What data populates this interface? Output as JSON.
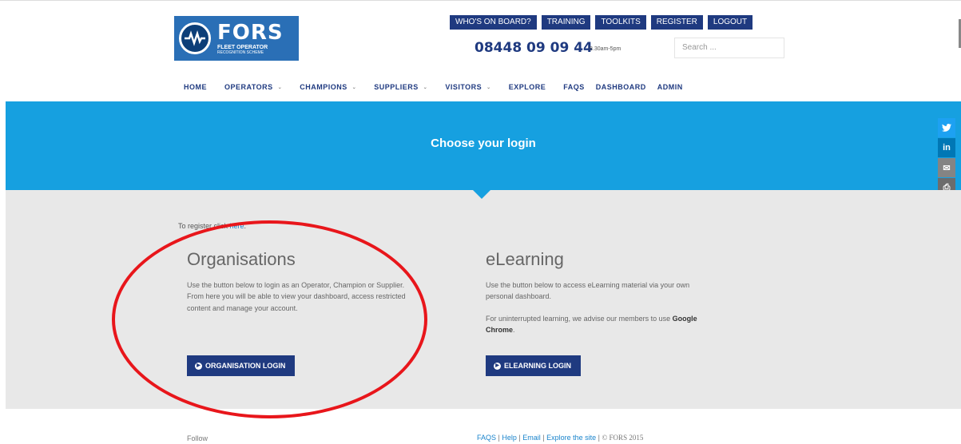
{
  "logo": {
    "title": "FORS",
    "subtitle": "FLEET OPERATOR",
    "tagline": "RECOGNITION SCHEME"
  },
  "top_buttons": [
    "WHO'S ON BOARD?",
    "TRAINING",
    "TOOLKITS",
    "REGISTER",
    "LOGOUT"
  ],
  "phone": "08448 09 09 44",
  "hours": "8.30am-5pm",
  "search": {
    "placeholder": "Search ..."
  },
  "nav": [
    {
      "label": "HOME",
      "dropdown": false
    },
    {
      "label": "OPERATORS",
      "dropdown": true
    },
    {
      "label": "CHAMPIONS",
      "dropdown": true
    },
    {
      "label": "SUPPLIERS",
      "dropdown": true
    },
    {
      "label": "VISITORS",
      "dropdown": true
    },
    {
      "label": "EXPLORE",
      "dropdown": false
    },
    {
      "label": "FAQS",
      "dropdown": false
    },
    {
      "label": "DASHBOARD",
      "dropdown": false
    },
    {
      "label": "ADMIN",
      "dropdown": false
    }
  ],
  "banner": {
    "title": "Choose your login"
  },
  "social": [
    {
      "icon": "twitter-icon",
      "glyph": "🐦",
      "color": "#1da1f2"
    },
    {
      "icon": "linkedin-icon",
      "glyph": "in",
      "color": "#0077b5"
    },
    {
      "icon": "email-icon",
      "glyph": "✉",
      "color": "#848484"
    },
    {
      "icon": "print-icon",
      "glyph": "⎙",
      "color": "#6c6c6c"
    }
  ],
  "register": {
    "prefix": "To register click",
    "link": "here",
    "suffix": "."
  },
  "organisations": {
    "title": "Organisations",
    "line1": "Use the button below to login as an Operator, Champion or Supplier.",
    "line2": "From here you will be able to view your dashboard, access restricted",
    "line3": "content and manage your account.",
    "button": "ORGANISATION LOGIN"
  },
  "elearning": {
    "title": "eLearning",
    "line1": "Use the button below to access eLearning material via your own",
    "line2": "personal dashboard.",
    "line3_prefix": "For uninterrupted learning, we advise our members to use",
    "line3_bold": "Google",
    "line4_bold": "Chrome",
    "line4_suffix": ".",
    "button": "ELEARNING LOGIN"
  },
  "footer": {
    "follow": "Follow",
    "links": [
      "FAQS",
      "Help",
      "Email",
      "Explore the site"
    ],
    "copyright": "© FORS 2015"
  },
  "colors": {
    "brand_navy": "#1f3a80",
    "banner_blue": "#16a0e0",
    "annotation_red": "#e8161b"
  }
}
